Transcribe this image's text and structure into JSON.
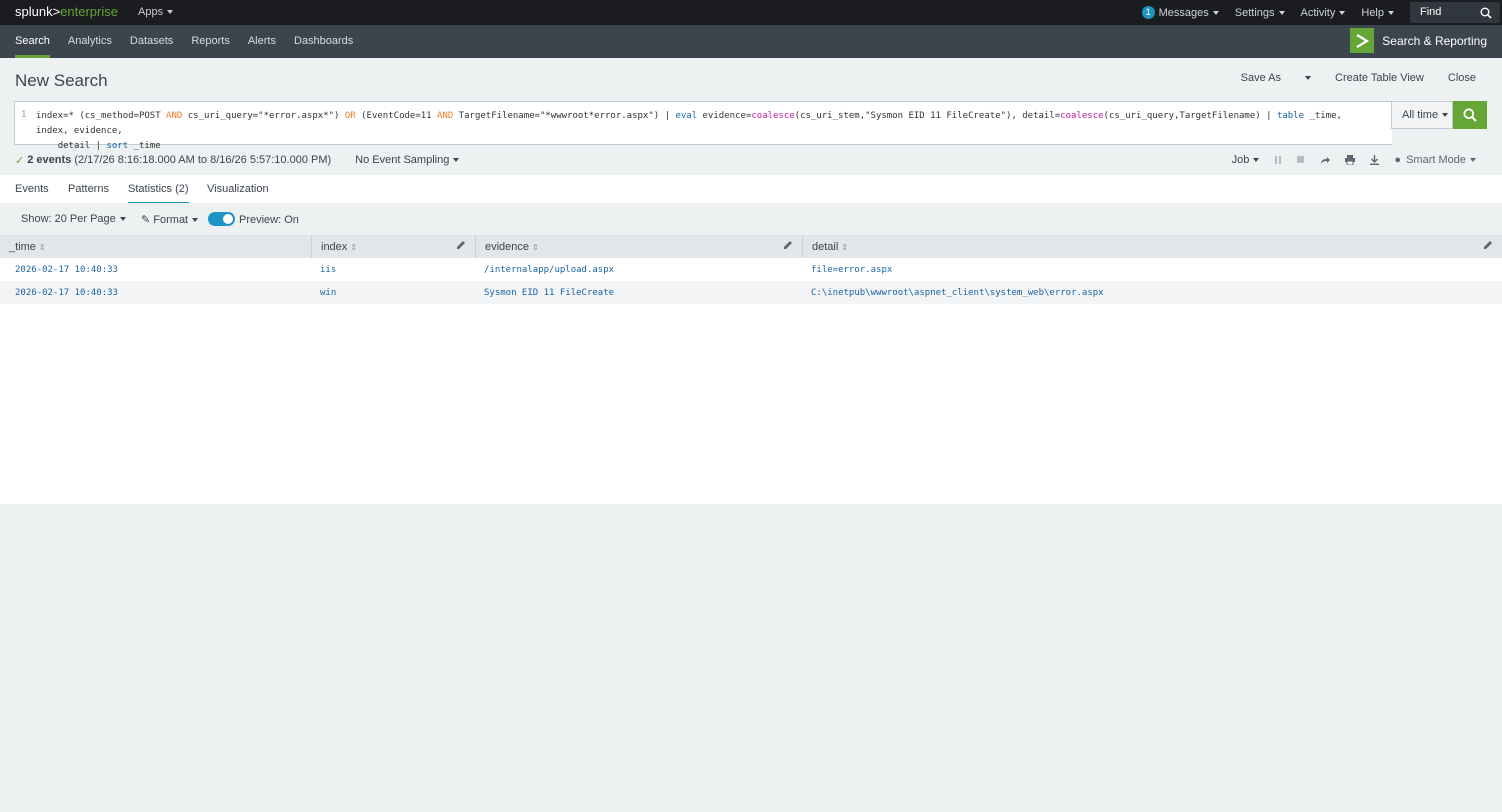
{
  "topbar": {
    "brand_main": "splunk>",
    "brand_sub": "enterprise",
    "apps": "Apps",
    "messages_count": "1",
    "messages": "Messages",
    "settings": "Settings",
    "activity": "Activity",
    "help": "Help",
    "find": "Find"
  },
  "appbar": {
    "tabs": [
      "Search",
      "Analytics",
      "Datasets",
      "Reports",
      "Alerts",
      "Dashboards"
    ],
    "app_name": "Search & Reporting"
  },
  "header": {
    "title": "New Search",
    "save_as": "Save As",
    "create_table_view": "Create Table View",
    "close": "Close"
  },
  "search": {
    "line_number": "1",
    "query_parts": [
      {
        "t": "index=* (cs_method=POST ",
        "c": ""
      },
      {
        "t": "AND",
        "c": "kw"
      },
      {
        "t": " cs_uri_query=\"*error.aspx*\") ",
        "c": ""
      },
      {
        "t": "OR",
        "c": "kw"
      },
      {
        "t": " (EventCode=11 ",
        "c": ""
      },
      {
        "t": "AND",
        "c": "kw"
      },
      {
        "t": " TargetFilename=\"*wwwroot*error.aspx\") | ",
        "c": ""
      },
      {
        "t": "eval",
        "c": "cmd"
      },
      {
        "t": " evidence=",
        "c": ""
      },
      {
        "t": "coalesce",
        "c": "fn"
      },
      {
        "t": "(cs_uri_stem,\"Sysmon EID 11 FileCreate\"), detail=",
        "c": ""
      },
      {
        "t": "coalesce",
        "c": "fn"
      },
      {
        "t": "(cs_uri_query,TargetFilename) | ",
        "c": ""
      },
      {
        "t": "table",
        "c": "cmd"
      },
      {
        "t": " _time, index, evidence,\n    detail | ",
        "c": ""
      },
      {
        "t": "sort",
        "c": "cmd"
      },
      {
        "t": " _time",
        "c": ""
      }
    ],
    "time_range": "All time"
  },
  "status": {
    "events_count": "2 events",
    "range": "(2/17/26 8:16:18.000 AM to 8/16/26 5:57:10.000 PM)",
    "sampling": "No Event Sampling",
    "job": "Job",
    "mode": "Smart Mode"
  },
  "result_tabs": [
    "Events",
    "Patterns",
    "Statistics (2)",
    "Visualization"
  ],
  "controls": {
    "per_page": "Show: 20 Per Page",
    "format": "Format",
    "preview": "Preview: On"
  },
  "table": {
    "columns": [
      "_time",
      "index",
      "evidence",
      "detail"
    ],
    "rows": [
      [
        "2026-02-17 10:40:33",
        "iis",
        "/internalapp/upload.aspx",
        "file=error.aspx"
      ],
      [
        "2026-02-17 10:40:33",
        "win",
        "Sysmon EID 11 FileCreate",
        "C:\\inetpub\\wwwroot\\aspnet_client\\system_web\\error.aspx"
      ]
    ]
  }
}
